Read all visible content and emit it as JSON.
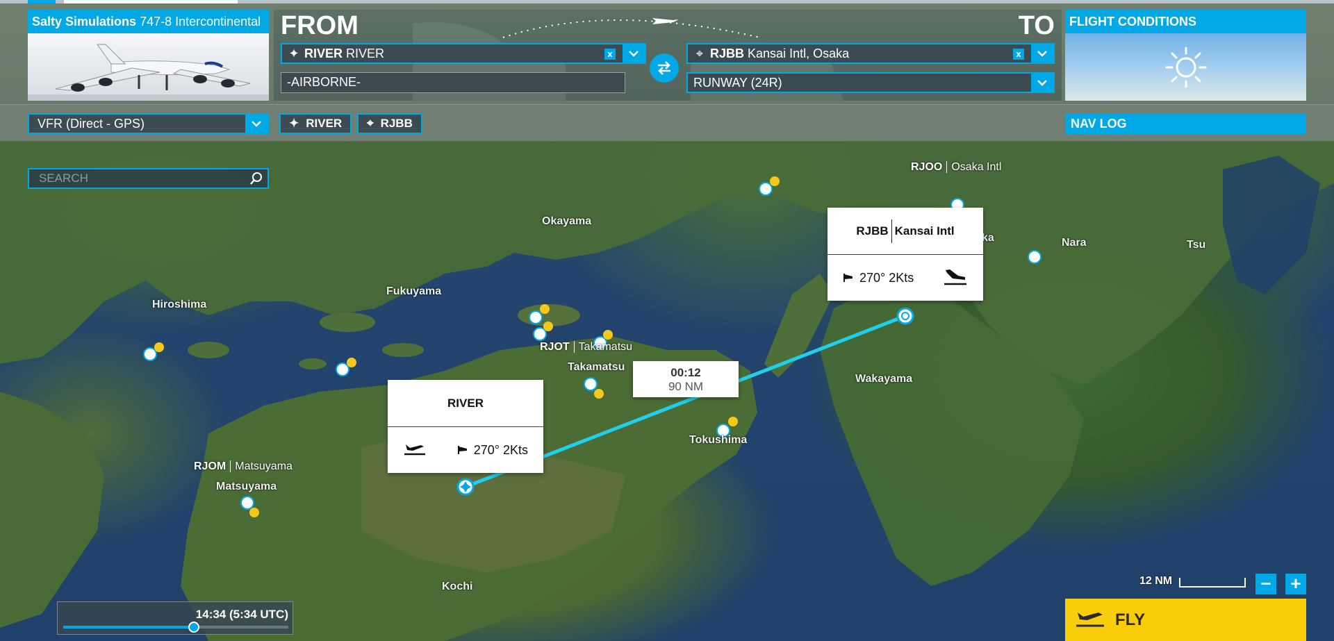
{
  "aircraft": {
    "brand": "Salty Simulations",
    "model": "747-8 Intercontinental"
  },
  "route": {
    "from_heading": "FROM",
    "to_heading": "TO",
    "departure": {
      "code": "RIVER",
      "name": "RIVER",
      "status": "-AIRBORNE-"
    },
    "arrival": {
      "code": "RJBB",
      "name": "Kansai Intl, Osaka",
      "runway": "RUNWAY (24R)"
    },
    "clear_symbol": "x"
  },
  "conditions": {
    "title": "FLIGHT CONDITIONS",
    "weather_icon": "sun-icon"
  },
  "toolbar": {
    "flight_type": "VFR (Direct - GPS)",
    "waypoint_from": "RIVER",
    "waypoint_to": "RJBB",
    "nav_log": "NAV LOG"
  },
  "search": {
    "placeholder": "SEARCH"
  },
  "map": {
    "places": [
      "Okayama",
      "Hiroshima",
      "Fukuyama",
      "Takamatsu",
      "Wakayama",
      "Tokushima",
      "Nara",
      "Tsu",
      "Kochi",
      "Matsuyama",
      "ka"
    ],
    "airports": [
      {
        "code": "RJOO",
        "name": "Osaka Intl"
      },
      {
        "code": "RJOT",
        "name": "Takamatsu"
      },
      {
        "code": "RJOM",
        "name": "Matsuyama"
      }
    ],
    "departure_card": {
      "title": "RIVER",
      "wind": "270° 2Kts"
    },
    "arrival_card": {
      "code": "RJBB",
      "name": "Kansai Intl",
      "wind": "270° 2Kts"
    },
    "leg": {
      "time": "00:12",
      "distance": "90 NM"
    },
    "scale": "12 NM",
    "zoom_out": "−",
    "zoom_in": "+"
  },
  "time": {
    "label": "14:34 (5:34 UTC)",
    "progress": 0.58
  },
  "fly": {
    "label": "FLY"
  },
  "colors": {
    "accent": "#00a8e6",
    "fly": "#f9cd0a",
    "route": "#1fd0ec"
  }
}
